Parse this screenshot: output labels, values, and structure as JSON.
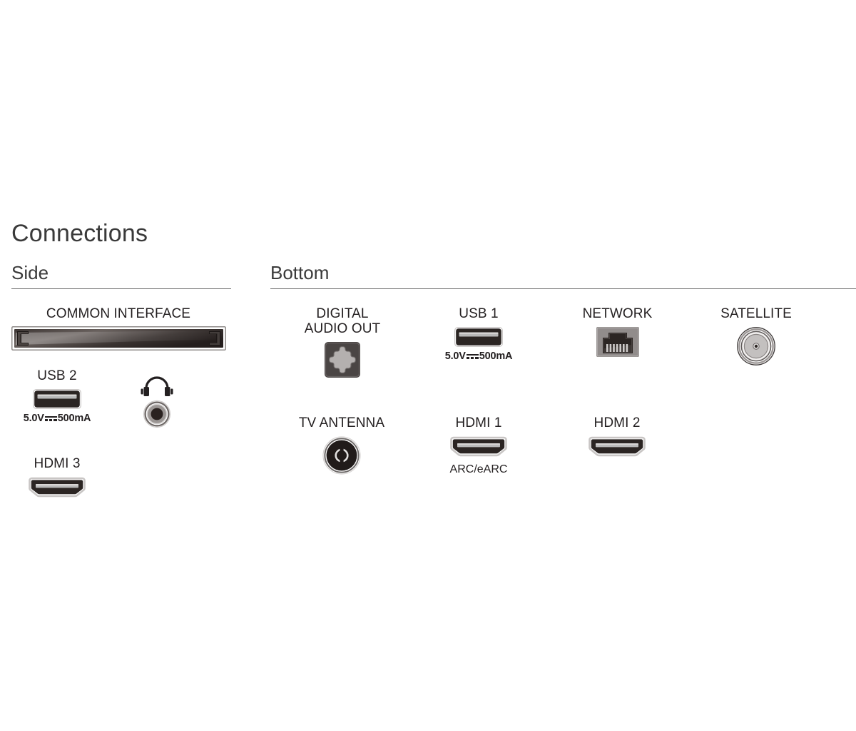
{
  "page": {
    "title": "Connections"
  },
  "sections": {
    "side": {
      "heading": "Side"
    },
    "bottom": {
      "heading": "Bottom"
    }
  },
  "side_ports": [
    {
      "label": "COMMON INTERFACE",
      "icon": "common-interface-slot-icon",
      "sub": ""
    },
    {
      "label": "USB 2",
      "icon": "usb-port-icon",
      "sub_prefix": "5.0V",
      "sub_suffix": "500mA"
    },
    {
      "label": "",
      "icon": "headphone-jack-icon",
      "sub": ""
    },
    {
      "label": "HDMI 3",
      "icon": "hdmi-port-icon",
      "sub": ""
    }
  ],
  "bottom_ports": [
    {
      "label": "DIGITAL\nAUDIO OUT",
      "icon": "optical-audio-port-icon",
      "sub": ""
    },
    {
      "label": "USB 1",
      "icon": "usb-port-icon",
      "sub_prefix": "5.0V",
      "sub_suffix": "500mA"
    },
    {
      "label": "NETWORK",
      "icon": "ethernet-rj45-port-icon",
      "sub": ""
    },
    {
      "label": "SATELLITE",
      "icon": "satellite-f-connector-icon",
      "sub": ""
    },
    {
      "label": "TV ANTENNA",
      "icon": "coax-antenna-connector-icon",
      "sub": ""
    },
    {
      "label": "HDMI 1",
      "icon": "hdmi-port-icon",
      "sub": "ARC/eARC"
    },
    {
      "label": "HDMI 2",
      "icon": "hdmi-port-icon",
      "sub": ""
    }
  ],
  "colors": {
    "text": "#231f20",
    "heading": "#3a3a3a",
    "rule": "#6d6d6d",
    "port_dark": "#2b2523",
    "port_light": "#b9b9b9",
    "background": "#ffffff"
  }
}
